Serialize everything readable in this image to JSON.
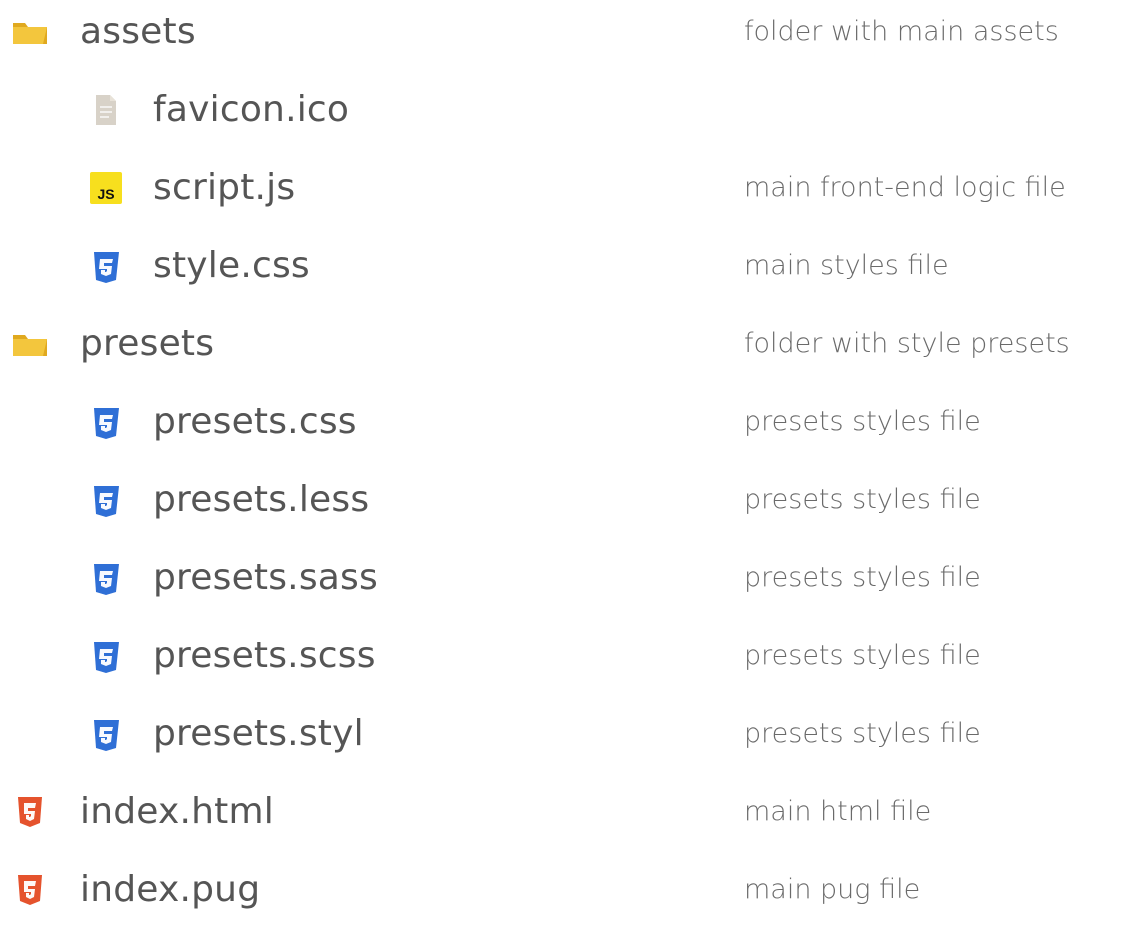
{
  "colors": {
    "folder": "#f3c63d",
    "folder_dark": "#e0a91f",
    "js_badge": "#f7df1e",
    "css_blue": "#2f6fd6",
    "html_orange": "#e5532d",
    "generic_file": "#d8d2c8",
    "text": "#555555",
    "desc": "#6a6a6a"
  },
  "rows": [
    {
      "name": "assets",
      "description": "folder with main assets",
      "type": "folder",
      "icon": "folder-icon",
      "depth": 0
    },
    {
      "name": "favicon.ico",
      "description": "",
      "type": "file",
      "icon": "file-icon",
      "depth": 1
    },
    {
      "name": "script.js",
      "description": "main front-end logic file",
      "type": "js",
      "icon": "js-icon",
      "depth": 1
    },
    {
      "name": "style.css",
      "description": "main styles file",
      "type": "css",
      "icon": "css-icon",
      "depth": 1
    },
    {
      "name": "presets",
      "description": "folder with style presets",
      "type": "folder",
      "icon": "folder-icon",
      "depth": 0
    },
    {
      "name": "presets.css",
      "description": "presets styles file",
      "type": "css",
      "icon": "css-icon",
      "depth": 1
    },
    {
      "name": "presets.less",
      "description": "presets styles file",
      "type": "css",
      "icon": "css-icon",
      "depth": 1
    },
    {
      "name": "presets.sass",
      "description": "presets styles file",
      "type": "css",
      "icon": "css-icon",
      "depth": 1
    },
    {
      "name": "presets.scss",
      "description": "presets styles file",
      "type": "css",
      "icon": "css-icon",
      "depth": 1
    },
    {
      "name": "presets.styl",
      "description": "presets styles file",
      "type": "css",
      "icon": "css-icon",
      "depth": 1
    },
    {
      "name": "index.html",
      "description": "main html file",
      "type": "html",
      "icon": "html-icon",
      "depth": 0
    },
    {
      "name": "index.pug",
      "description": "main pug file",
      "type": "html",
      "icon": "html-icon",
      "depth": 0
    }
  ]
}
